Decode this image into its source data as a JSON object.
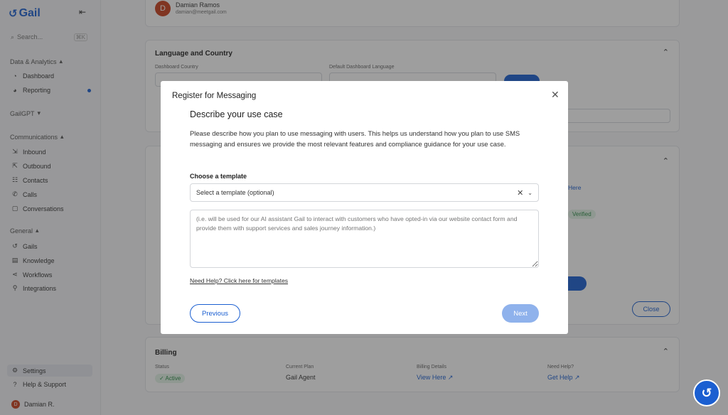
{
  "sidebar": {
    "logo": "Gail",
    "search_placeholder": "Search...",
    "search_shortcut": "⌘K",
    "sections": {
      "data_analytics": "Data & Analytics",
      "gailgpt": "GailGPT",
      "communications": "Communications",
      "general": "General"
    },
    "items": {
      "dashboard": "Dashboard",
      "reporting": "Reporting",
      "inbound": "Inbound",
      "outbound": "Outbound",
      "contacts": "Contacts",
      "calls": "Calls",
      "conversations": "Conversations",
      "gails": "Gails",
      "knowledge": "Knowledge",
      "workflows": "Workflows",
      "integrations": "Integrations",
      "settings": "Settings",
      "help": "Help & Support",
      "user": "Damian R."
    }
  },
  "main": {
    "profile": {
      "initial": "D",
      "name": "Damian Ramos",
      "email": "damian@meetgail.com"
    },
    "language_card": {
      "title": "Language and Country",
      "country_label": "Dashboard Country",
      "language_label": "Default Dashboard Language"
    },
    "phone_card": {
      "close": "Close",
      "verified": "Verified",
      "here": "Here"
    },
    "billing": {
      "title": "Billing",
      "status_label": "Status",
      "status_value": "Active",
      "plan_label": "Current Plan",
      "plan_value": "Gail Agent",
      "details_label": "Billing Details",
      "details_value": "View Here",
      "help_label": "Need Help?",
      "help_value": "Get Help"
    }
  },
  "modal": {
    "title": "Register for Messaging",
    "heading": "Describe your use case",
    "description": "Please describe how you plan to use messaging with users. This helps us understand how you plan to use SMS messaging and ensures we provide the most relevant features and compliance guidance for your use case.",
    "template_label": "Choose a template",
    "template_placeholder": "Select a template (optional)",
    "textarea_placeholder": "(i.e. will be used for our AI assistant Gail to interact with customers who have opted-in via our website contact form and provide them with support services and sales journey information.)",
    "help_link": "Need Help? Click here for templates",
    "previous": "Previous",
    "next": "Next"
  }
}
